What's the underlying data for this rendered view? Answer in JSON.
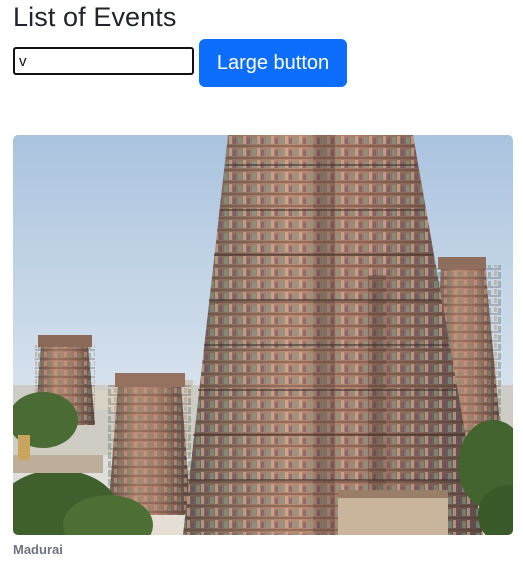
{
  "page": {
    "title": "List of Events"
  },
  "search": {
    "value": "v",
    "placeholder": ""
  },
  "toolbar": {
    "large_button_label": "Large button"
  },
  "event": {
    "image_alt": "Madurai temple gopuram",
    "caption": "Madurai"
  },
  "colors": {
    "primary_button": "#0d6efd",
    "caption_text": "#6c757d"
  }
}
